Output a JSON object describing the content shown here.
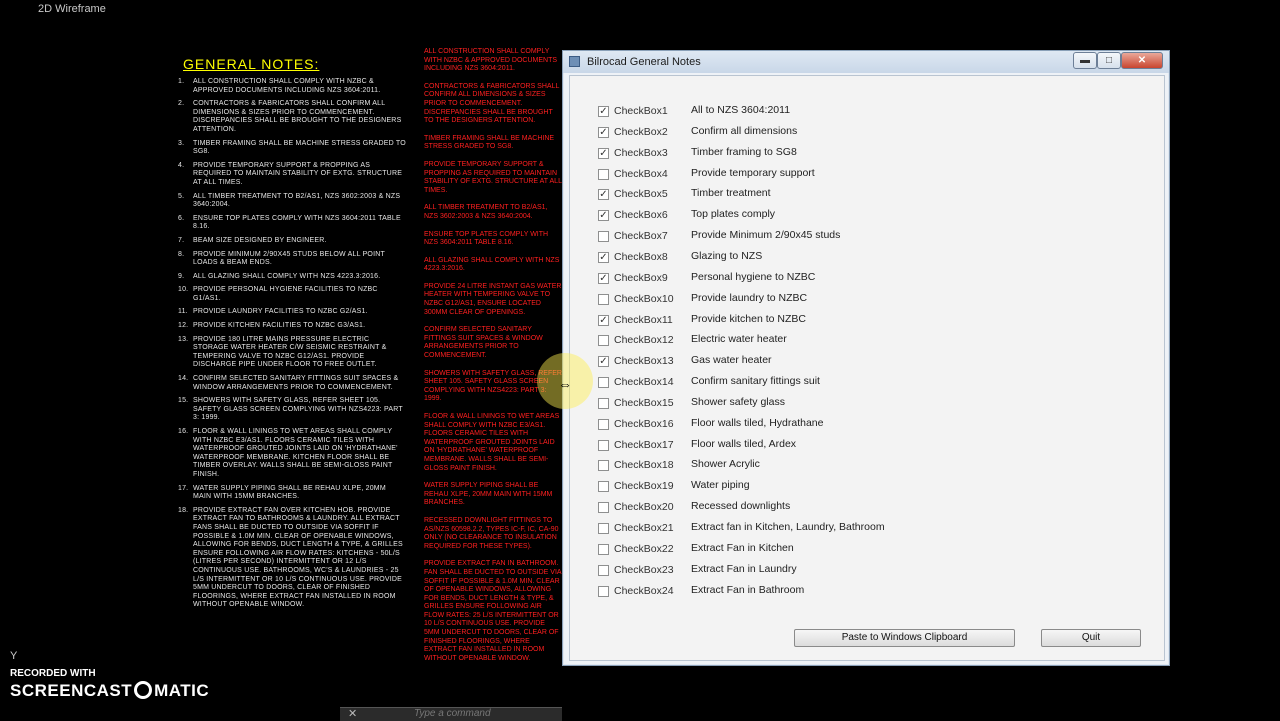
{
  "cad": {
    "viewport_label": "2D Wireframe",
    "notes_title": "GENERAL NOTES:",
    "notes": [
      {
        "num": "1.",
        "text": "All construction shall comply with NZBC & approved documents including NZS 3604:2011."
      },
      {
        "num": "2.",
        "text": "Contractors & fabricators shall confirm all dimensions & sizes prior to commencement. Discrepancies shall be brought to the designers attention."
      },
      {
        "num": "3.",
        "text": "Timber framing shall be machine stress graded to SG8."
      },
      {
        "num": "4.",
        "text": "Provide temporary support & propping as required to maintain stability of extg. structure at all times."
      },
      {
        "num": "5.",
        "text": "All timber treatment to B2/AS1, NZS 3602:2003 & NZS 3640:2004."
      },
      {
        "num": "6.",
        "text": "Ensure top plates comply with NZS 3604:2011 table 8.16."
      },
      {
        "num": "7.",
        "text": "Beam size designed by engineer."
      },
      {
        "num": "8.",
        "text": "Provide minimum 2/90x45 studs below all point loads & beam ends."
      },
      {
        "num": "9.",
        "text": "All glazing shall comply with NZS 4223.3:2016."
      },
      {
        "num": "10.",
        "text": "Provide personal hygiene facilities to NZBC G1/AS1."
      },
      {
        "num": "11.",
        "text": "Provide laundry facilities to NZBC G2/AS1."
      },
      {
        "num": "12.",
        "text": "Provide kitchen facilities to NZBC G3/AS1."
      },
      {
        "num": "13.",
        "text": "Provide 180 litre mains pressure electric storage water heater c/w seismic restraint & tempering valve to NZBC G12/AS1. Provide discharge pipe under floor to free outlet."
      },
      {
        "num": "14.",
        "text": "Confirm selected sanitary fittings suit spaces & window arrangements prior to commencement."
      },
      {
        "num": "15.",
        "text": "Showers with safety glass, refer sheet 105. Safety glass screen complying with NZS4223: Part 3: 1999."
      },
      {
        "num": "16.",
        "text": "Floor & wall linings to wet areas shall comply with NZBC E3/AS1. Floors ceramic tiles with waterproof grouted joints laid on 'Hydrathane' waterproof membrane. Kitchen floor shall be timber overlay. Walls shall be semi-gloss paint finish."
      },
      {
        "num": "17.",
        "text": "Water supply piping shall be Rehau XLPE, 20mm main with 15mm branches."
      },
      {
        "num": "18.",
        "text": "Provide extract fan over kitchen hob. Provide extract fan to bathrooms & laundry. All extract fans shall be ducted to outside via soffit if possible & 1.0m min. clear of openable windows, allowing for bends, duct length & type, & grilles ensure following air flow rates: Kitchens - 50l/s (litres per second) intermittent or 12 l/s continuous use. Bathrooms, WC's & laundries - 25 l/s intermittent or 10 l/s continuous use. Provide 5mm undercut to doors, clear of finished floorings, where extract fan installed in room without openable window."
      }
    ],
    "red_notes": [
      "All construction shall comply with NZBC & approved documents including NZS 3604:2011.",
      "Contractors & fabricators shall confirm all dimensions & sizes prior to commencement. Discrepancies shall be brought to the designers attention.",
      "Timber framing shall be machine stress graded to SG8.",
      "Provide temporary support & propping as required to maintain stability of extg. structure at all times.",
      "All timber treatment to B2/AS1, NZS 3602:2003 & NZS 3640:2004.",
      "Ensure top plates comply with NZS 3604:2011 table 8.16.",
      "All glazing shall comply with NZS 4223.3:2016.",
      "Provide 24 litre instant gas water heater with tempering valve to NZBC G12/AS1, ensure located 300mm clear of openings.",
      "Confirm selected sanitary fittings suit spaces & window arrangements prior to commencement.",
      "Showers with safety glass, refer sheet 105. Safety glass screen complying with NZS4223: Part 3: 1999.",
      "Floor & wall linings to wet areas shall comply with NZBC E3/AS1. Floors ceramic tiles with waterproof grouted joints laid on 'Hydrathane' waterproof membrane. Walls shall be semi-gloss paint finish.",
      "Water supply piping shall be Rehau XLPE, 20mm main with 15mm branches.",
      "Recessed downlight fittings to AS/NZS 60598.2.2, types IC-F, IC, CA-90 only (no clearance to insulation required for these types).",
      "Provide extract fan in bathroom. Fan shall be ducted to outside via soffit if possible & 1.0m min. clear of openable windows, allowing for bends, duct length & type, & grilles ensure following air flow rates: 25 l/s intermittent or 10 l/s continuous use. Provide 5mm undercut to doors, clear of finished floorings, where extract fan installed in room without openable window."
    ],
    "command_placeholder": "Type a command"
  },
  "window": {
    "title": "Bilrocad General Notes",
    "min_label": "▬",
    "max_label": "□",
    "close_label": "✕",
    "checkboxes": [
      {
        "name": "CheckBox1",
        "label": "All to NZS 3604:2011",
        "checked": true
      },
      {
        "name": "CheckBox2",
        "label": "Confirm all dimensions",
        "checked": true
      },
      {
        "name": "CheckBox3",
        "label": "Timber framing to SG8",
        "checked": true
      },
      {
        "name": "CheckBox4",
        "label": "Provide temporary support",
        "checked": false
      },
      {
        "name": "CheckBox5",
        "label": "Timber treatment",
        "checked": true
      },
      {
        "name": "CheckBox6",
        "label": "Top plates comply",
        "checked": true
      },
      {
        "name": "CheckBox7",
        "label": "Provide Minimum 2/90x45 studs",
        "checked": false
      },
      {
        "name": "CheckBox8",
        "label": "Glazing to NZS",
        "checked": true
      },
      {
        "name": "CheckBox9",
        "label": "Personal hygiene to NZBC",
        "checked": true
      },
      {
        "name": "CheckBox10",
        "label": "Provide laundry to NZBC",
        "checked": false
      },
      {
        "name": "CheckBox11",
        "label": "Provide kitchen to NZBC",
        "checked": true
      },
      {
        "name": "CheckBox12",
        "label": "Electric water heater",
        "checked": false
      },
      {
        "name": "CheckBox13",
        "label": "Gas water heater",
        "checked": true
      },
      {
        "name": "CheckBox14",
        "label": "Confirm sanitary fittings suit",
        "checked": false
      },
      {
        "name": "CheckBox15",
        "label": "Shower safety glass",
        "checked": false
      },
      {
        "name": "CheckBox16",
        "label": "Floor walls tiled, Hydrathane",
        "checked": false
      },
      {
        "name": "CheckBox17",
        "label": "Floor walls tiled, Ardex",
        "checked": false
      },
      {
        "name": "CheckBox18",
        "label": "Shower Acrylic",
        "checked": false
      },
      {
        "name": "CheckBox19",
        "label": "Water piping",
        "checked": false
      },
      {
        "name": "CheckBox20",
        "label": "Recessed downlights",
        "checked": false
      },
      {
        "name": "CheckBox21",
        "label": "Extract fan in Kitchen, Laundry,  Bathroom",
        "checked": false
      },
      {
        "name": "CheckBox22",
        "label": "Extract Fan in Kitchen",
        "checked": false
      },
      {
        "name": "CheckBox23",
        "label": "Extract Fan in Laundry",
        "checked": false
      },
      {
        "name": "CheckBox24",
        "label": "Extract Fan in Bathroom",
        "checked": false
      }
    ],
    "paste_label": "Paste to Windows Clipboard",
    "quit_label": "Quit"
  },
  "watermark": {
    "line1": "RECORDED WITH",
    "line2a": "SCREENCAST",
    "line2b": "MATIC"
  }
}
